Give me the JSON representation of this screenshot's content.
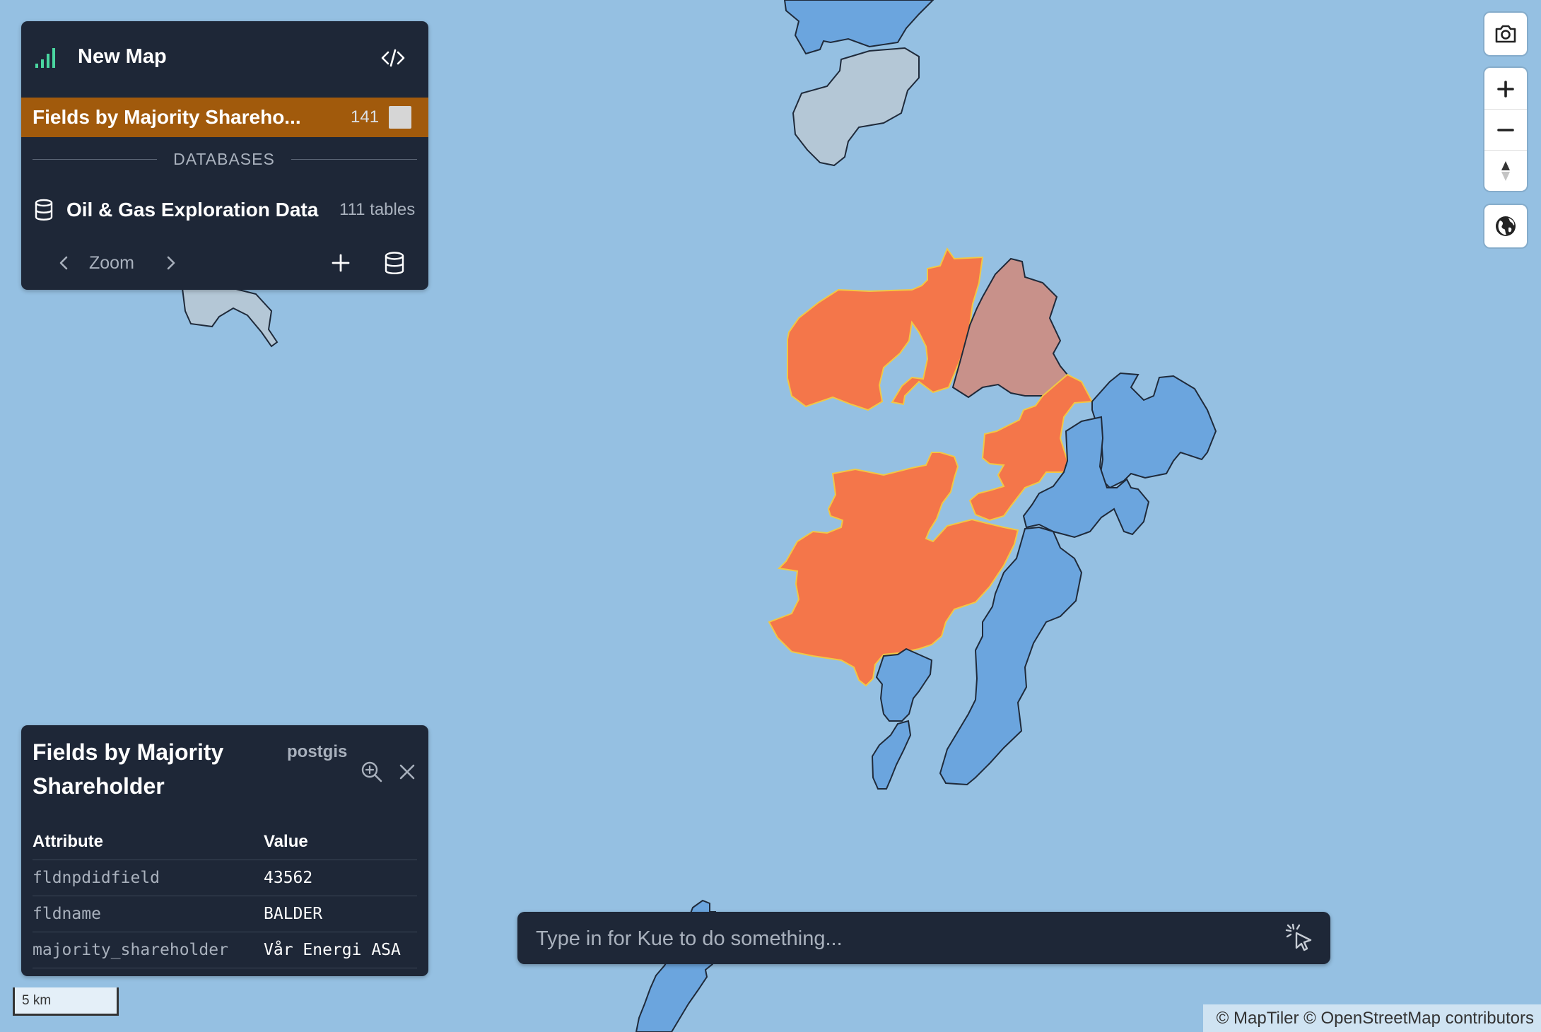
{
  "header": {
    "app_icon": "bar-chart-icon",
    "title": "New Map",
    "code_icon": "code-icon"
  },
  "layers": [
    {
      "name": "Fields by Majority Shareho...",
      "count": "141",
      "swatch_color": "#d6d6d6",
      "highlight_color": "#a15a0c"
    }
  ],
  "databases": {
    "heading": "DATABASES",
    "items": [
      {
        "icon": "database-icon",
        "name": "Oil & Gas Exploration Data",
        "count": "111 tables"
      }
    ]
  },
  "footer": {
    "prev_icon": "chevron-left-icon",
    "zoom_label": "Zoom",
    "next_icon": "chevron-right-icon",
    "add_icon": "plus-icon",
    "db_icon": "database-icon"
  },
  "feature": {
    "title": "Fields by Majority Shareholder",
    "source": "postgis",
    "zoom_icon": "zoom-in-icon",
    "close_icon": "close-icon",
    "columns": [
      "Attribute",
      "Value"
    ],
    "rows": [
      {
        "attribute": "fldnpdidfield",
        "value": "43562"
      },
      {
        "attribute": "fldname",
        "value": "BALDER"
      },
      {
        "attribute": "majority_shareholder",
        "value": "Vår Energi ASA"
      }
    ]
  },
  "map_controls": {
    "camera_icon": "camera-icon",
    "zoom_in_icon": "plus-icon",
    "zoom_out_icon": "minus-icon",
    "compass_icon": "compass-icon",
    "globe_icon": "globe-icon"
  },
  "prompt": {
    "placeholder": "Type in for Kue to do something...",
    "submit_icon": "sparkle-cursor-icon"
  },
  "scale": {
    "label": "5 km"
  },
  "attribution": "© MapTiler © OpenStreetMap contributors",
  "map_colors": {
    "water": "#95c0e2",
    "vaar_energi": "#f4764a",
    "other_shareholder": "#6ba5de",
    "selected_neighbor": "#c8918a",
    "unassigned": "#b4c7d6"
  }
}
